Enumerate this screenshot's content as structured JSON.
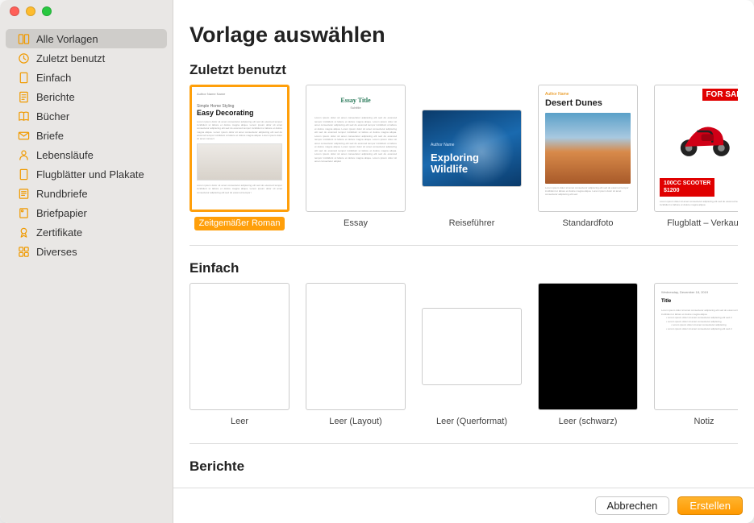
{
  "sidebar": {
    "items": [
      {
        "label": "Alle Vorlagen",
        "icon": "templates-all-icon",
        "selected": true
      },
      {
        "label": "Zuletzt benutzt",
        "icon": "clock-icon"
      },
      {
        "label": "Einfach",
        "icon": "page-icon"
      },
      {
        "label": "Berichte",
        "icon": "report-icon"
      },
      {
        "label": "Bücher",
        "icon": "book-icon"
      },
      {
        "label": "Briefe",
        "icon": "envelope-icon"
      },
      {
        "label": "Lebensläufe",
        "icon": "person-icon"
      },
      {
        "label": "Flugblätter und Plakate",
        "icon": "page-icon"
      },
      {
        "label": "Rundbriefe",
        "icon": "newsletter-icon"
      },
      {
        "label": "Briefpapier",
        "icon": "stationery-icon"
      },
      {
        "label": "Zertifikate",
        "icon": "ribbon-icon"
      },
      {
        "label": "Diverses",
        "icon": "misc-icon"
      }
    ]
  },
  "header": {
    "title": "Vorlage auswählen"
  },
  "sections": [
    {
      "title": "Zuletzt benutzt",
      "templates": [
        {
          "label": "Zeitgemäßer Roman",
          "kind": "roman",
          "selected": true,
          "preview": {
            "author": "Author Name Name",
            "subtitle": "Simple Home Styling",
            "title": "Easy Decorating"
          }
        },
        {
          "label": "Essay",
          "kind": "essay",
          "preview": {
            "title": "Essay Title",
            "subtitle": "Subtitle"
          }
        },
        {
          "label": "Reiseführer",
          "kind": "travel",
          "preview": {
            "author": "Author Name",
            "title1": "Exploring",
            "title2": "Wildlife"
          }
        },
        {
          "label": "Standardfoto",
          "kind": "photo",
          "preview": {
            "author": "Author Name",
            "title": "Desert Dunes"
          }
        },
        {
          "label": "Flugblatt – Verkauf",
          "kind": "flyer",
          "preview": {
            "banner": "FOR SALE",
            "line1": "100CC SCOOTER",
            "line2": "$1200"
          }
        }
      ]
    },
    {
      "title": "Einfach",
      "templates": [
        {
          "label": "Leer",
          "kind": "blank"
        },
        {
          "label": "Leer (Layout)",
          "kind": "blank"
        },
        {
          "label": "Leer (Querformat)",
          "kind": "blank-landscape"
        },
        {
          "label": "Leer (schwarz)",
          "kind": "black"
        },
        {
          "label": "Notiz",
          "kind": "note",
          "preview": {
            "date": "Wednesday, December 18, 2019",
            "title": "Title"
          }
        }
      ]
    },
    {
      "title": "Berichte",
      "templates": []
    }
  ],
  "footer": {
    "cancel": "Abbrechen",
    "create": "Erstellen"
  },
  "colors": {
    "accent": "#ff9f0a"
  }
}
